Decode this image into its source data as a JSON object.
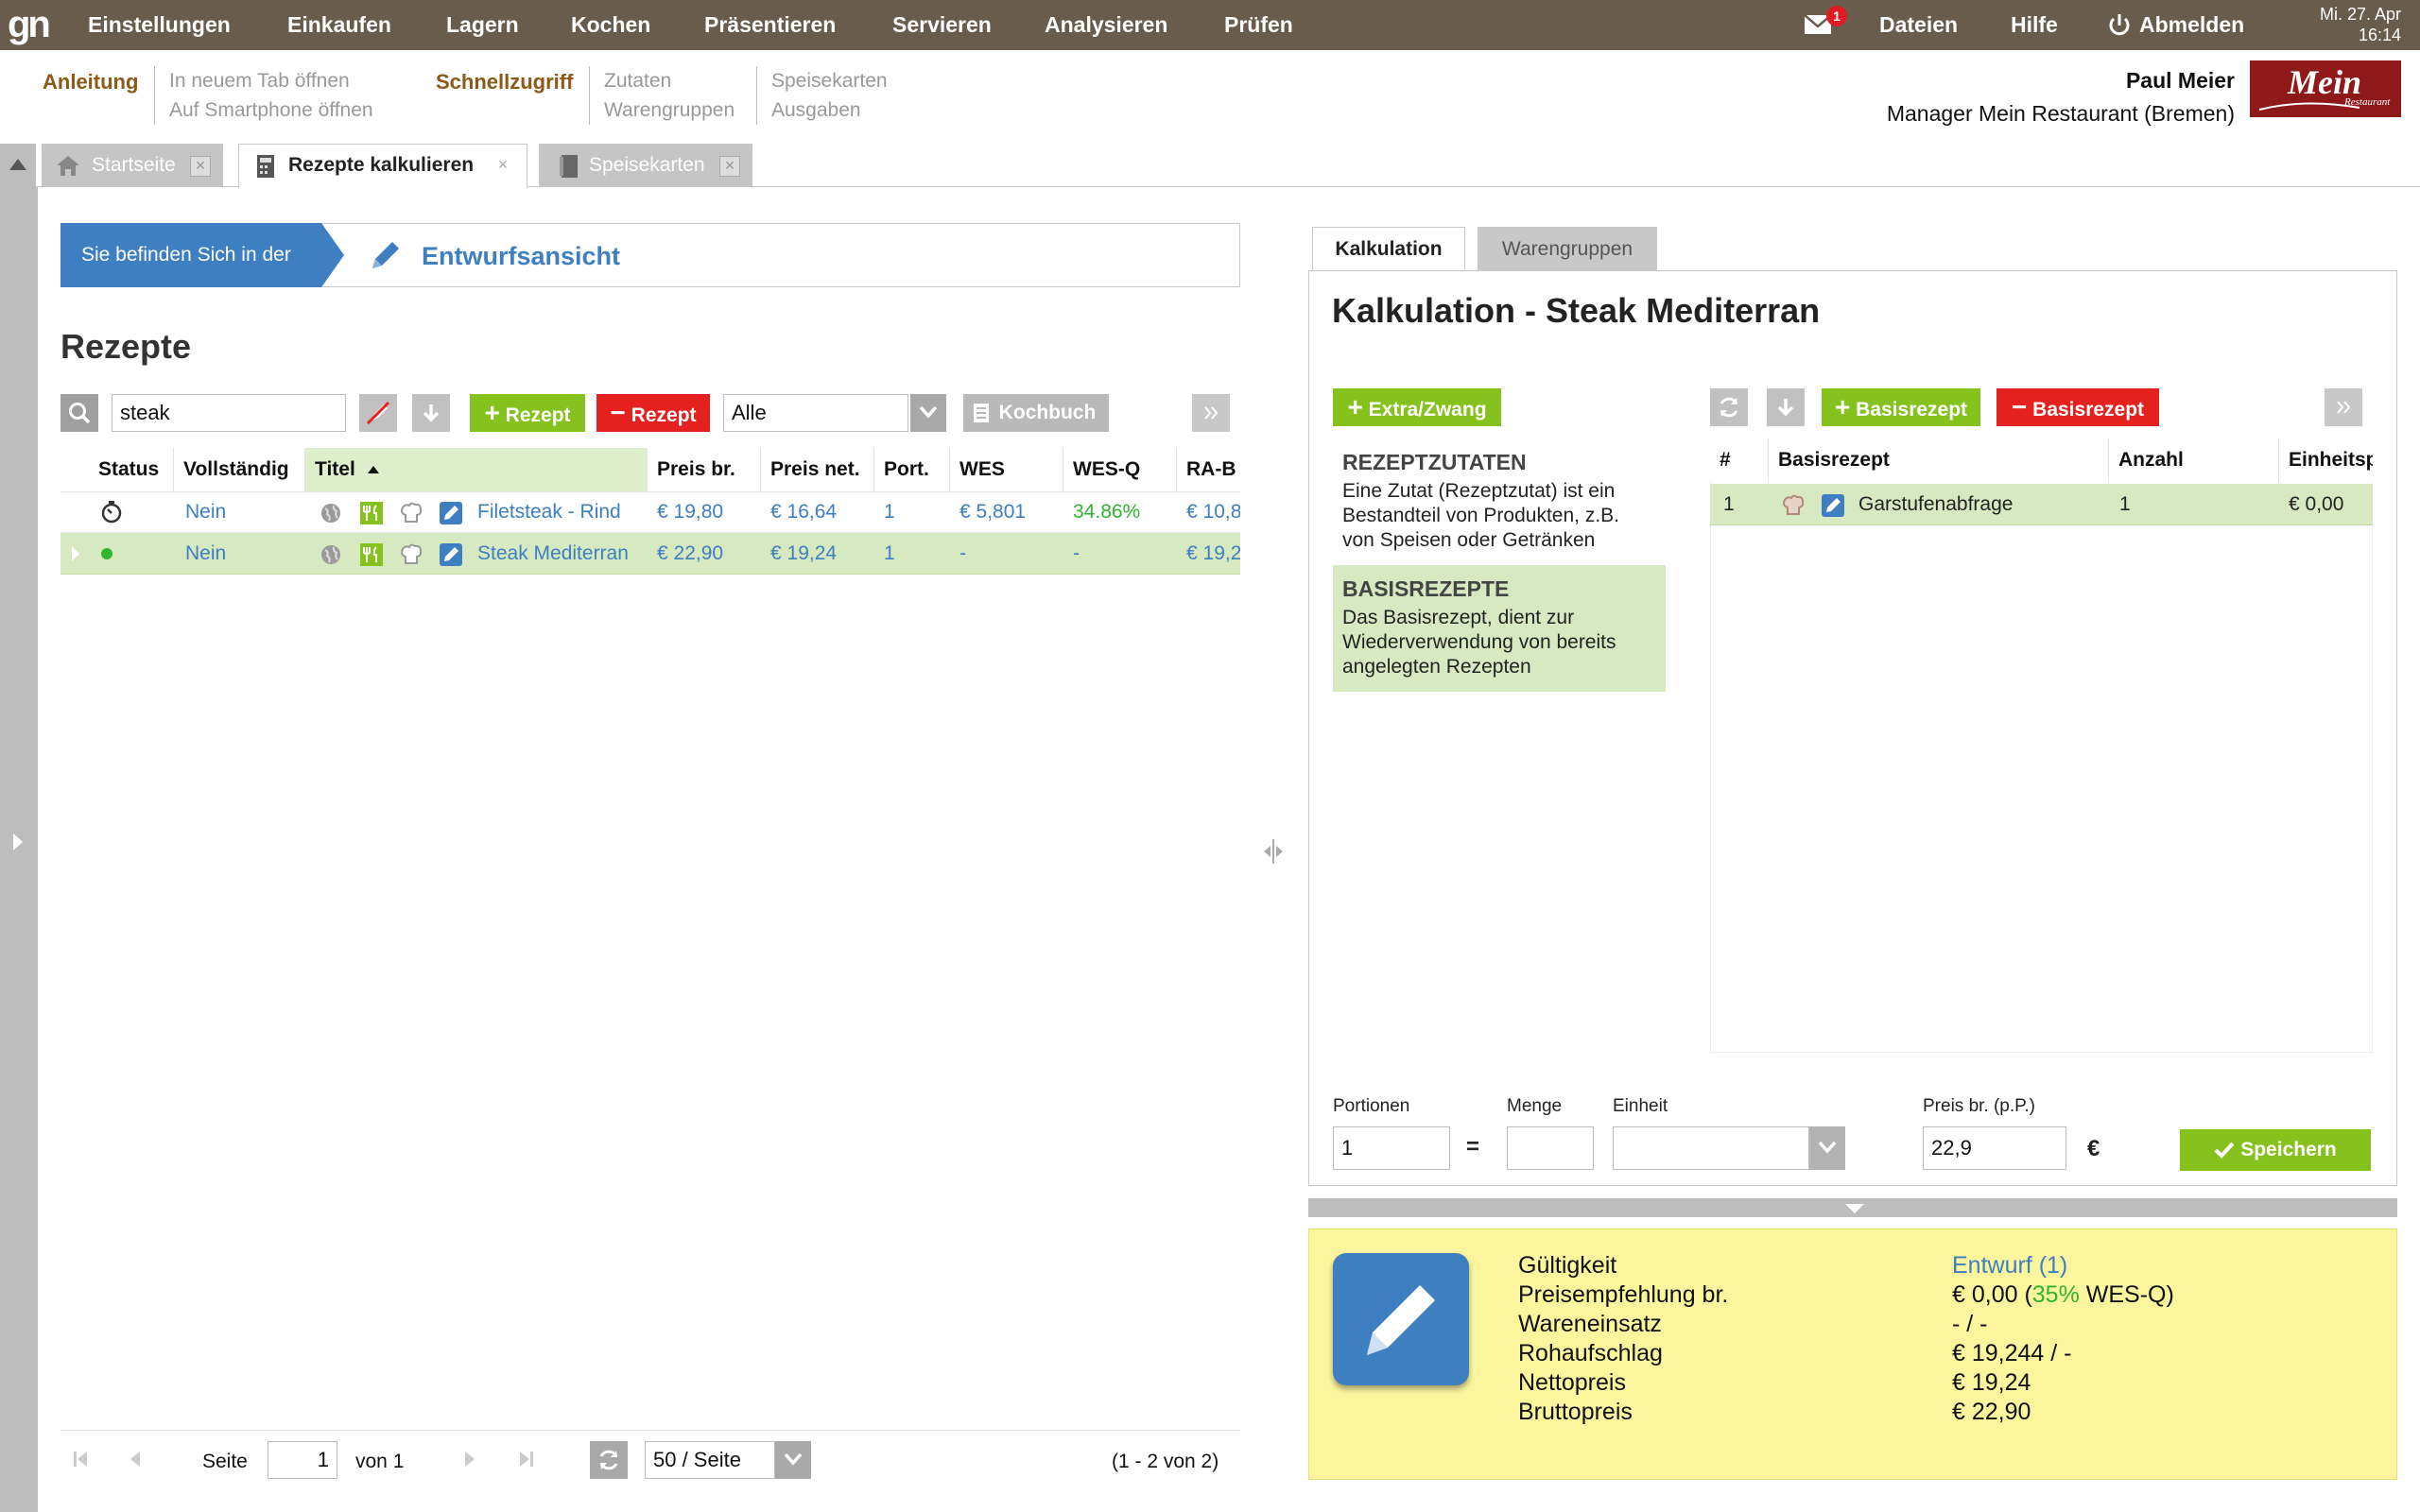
{
  "topbar": {
    "logo": "gn",
    "menu": [
      "Einstellungen",
      "Einkaufen",
      "Lagern",
      "Kochen",
      "Präsentieren",
      "Servieren",
      "Analysieren",
      "Prüfen"
    ],
    "mail_count": "1",
    "right": {
      "files": "Dateien",
      "help": "Hilfe",
      "logout": "Abmelden"
    },
    "date": "Mi. 27. Apr",
    "time": "16:14"
  },
  "subheader": {
    "guide": "Anleitung",
    "guide_links": [
      "In neuem Tab öffnen",
      "Auf Smartphone öffnen"
    ],
    "quick": "Schnellzugriff",
    "quick_col1": [
      "Zutaten",
      "Warengruppen"
    ],
    "quick_col2": [
      "Speisekarten",
      "Ausgaben"
    ],
    "user_name": "Paul Meier",
    "user_role": "Manager Mein Restaurant (Bremen)",
    "brand": "Mein",
    "brand_sub": "Restaurant"
  },
  "tabs": [
    {
      "label": "Startseite"
    },
    {
      "label": "Rezepte kalkulieren"
    },
    {
      "label": "Speisekarten"
    }
  ],
  "breadcrumb": {
    "prefix": "Sie befinden Sich in der",
    "title": "Entwurfsansicht"
  },
  "recipes": {
    "title": "Rezepte",
    "search_value": "steak",
    "add_label": "Rezept",
    "remove_label": "Rezept",
    "filter_value": "Alle",
    "cookbook_label": "Kochbuch",
    "columns": [
      "Status",
      "Vollständig",
      "Titel",
      "Preis br.",
      "Preis net.",
      "Port.",
      "WES",
      "WES-Q",
      "RA-B"
    ],
    "rows": [
      {
        "complete": "Nein",
        "title": "Filetsteak - Rind",
        "price_gross": "€ 19,80",
        "price_net": "€ 16,64",
        "portions": "1",
        "wes": "€ 5,801",
        "wesq": "34.86%",
        "rab": "€ 10,8"
      },
      {
        "complete": "Nein",
        "title": "Steak Mediterran",
        "price_gross": "€ 22,90",
        "price_net": "€ 19,24",
        "portions": "1",
        "wes": "-",
        "wesq": "-",
        "rab": "€ 19,2"
      }
    ],
    "pager": {
      "page_label": "Seite",
      "page": "1",
      "of_label": "von 1",
      "per_page": "50 / Seite",
      "summary": "(1 - 2 von 2)"
    }
  },
  "calc": {
    "tabs": [
      "Kalkulation",
      "Warengruppen"
    ],
    "title": "Kalkulation - Steak Mediterran",
    "extra_label": "Extra/Zwang",
    "add_base_label": "Basisrezept",
    "remove_base_label": "Basisrezept",
    "boxes": [
      {
        "title": "REZEPTZUTATEN",
        "text": "Eine Zutat (Rezeptzutat) ist ein Bestandteil von Produkten, z.B. von Speisen oder Getränken"
      },
      {
        "title": "BASISREZEPTE",
        "text": "Das Basisrezept, dient zur Wiederverwendung von bereits angelegten Rezepten"
      }
    ],
    "grid_columns": [
      "#",
      "Basisrezept",
      "Anzahl",
      "Einheitspreis"
    ],
    "grid_rows": [
      {
        "num": "1",
        "name": "Garstufenabfrage",
        "count": "1",
        "unit_price": "€ 0,00"
      }
    ],
    "form": {
      "portions_label": "Portionen",
      "portions_value": "1",
      "equals": "=",
      "amount_label": "Menge",
      "amount_value": "",
      "unit_label": "Einheit",
      "unit_value": "",
      "price_label": "Preis br. (p.P.)",
      "price_value": "22,9",
      "currency": "€",
      "save_label": "Speichern"
    }
  },
  "info": {
    "labels": [
      "Gültigkeit",
      "Preisempfehlung br.",
      "Wareneinsatz",
      "Rohaufschlag",
      "Nettopreis",
      "Bruttopreis"
    ],
    "validity": "Entwurf (1)",
    "recommend_a": "€ 0,00 (",
    "recommend_pct": "35%",
    "recommend_b": " WES-Q)",
    "goods": "- / -",
    "markup": "€ 19,244 / -",
    "net": "€ 19,24",
    "gross": "€ 22,90"
  },
  "colors": {
    "topbar": "#6a5c4c",
    "accent_blue": "#3d7fc1",
    "green": "#85c21e",
    "red": "#e4211f",
    "brown": "#8b5a16",
    "info_yellow": "#fbf59e"
  }
}
